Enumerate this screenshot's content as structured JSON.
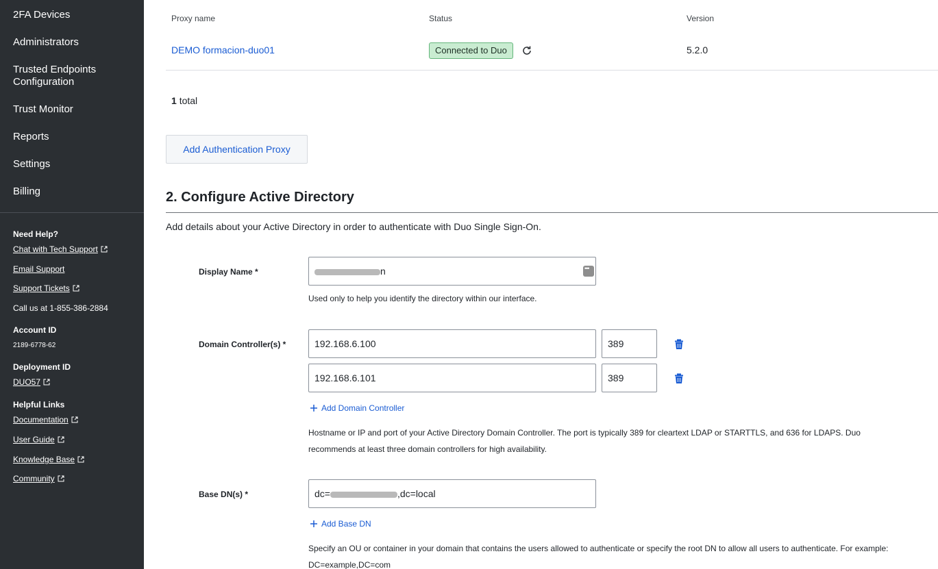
{
  "sidebar": {
    "nav": [
      "2FA Devices",
      "Administrators",
      "Trusted Endpoints\nConfiguration",
      "Trust Monitor",
      "Reports",
      "Settings",
      "Billing"
    ],
    "need_help": "Need Help?",
    "chat": "Chat with Tech Support",
    "email": "Email Support",
    "tickets": "Support Tickets",
    "call": "Call us at 1-855-386-2884",
    "account_id_label": "Account ID",
    "account_id": "2189-6778-62",
    "deployment_id_label": "Deployment ID",
    "deployment_id": "DUO57",
    "helpful_links": "Helpful Links",
    "documentation": "Documentation",
    "user_guide": "User Guide",
    "knowledge_base": "Knowledge Base",
    "community": "Community"
  },
  "proxy_table": {
    "col_name": "Proxy name",
    "col_status": "Status",
    "col_version": "Version",
    "row": {
      "name": "DEMO formacion-duo01",
      "status": "Connected to Duo",
      "version": "5.2.0"
    },
    "total_count": "1",
    "total_label": "total",
    "add_button": "Add Authentication Proxy"
  },
  "section": {
    "title": "2. Configure Active Directory",
    "description": "Add details about your Active Directory in order to authenticate with Duo Single Sign-On."
  },
  "display_name": {
    "label": "Display Name *",
    "value_suffix": "n",
    "help": "Used only to help you identify the directory within our interface."
  },
  "domain_controllers": {
    "label": "Domain Controller(s) *",
    "hosts": [
      "192.168.6.100",
      "192.168.6.101"
    ],
    "ports": [
      "389",
      "389"
    ],
    "add_label": "Add Domain Controller",
    "help_line1": "Hostname or IP and port of your Active Directory Domain Controller. The port is typically 389 for cleartext LDAP or STARTTLS, and 636 for LDAPS. Duo",
    "help_line2": "recommends at least three domain controllers for high availability."
  },
  "base_dn": {
    "label": "Base DN(s) *",
    "value_prefix": "dc=",
    "value_suffix": ",dc=local",
    "add_label": "Add Base DN",
    "help_line1": "Specify an OU or container in your domain that contains the users allowed to authenticate or specify the root DN to allow all users to authenticate. For example:",
    "help_line2": "DC=example,DC=com"
  },
  "colors": {
    "link": "#1a5cd3",
    "sidebar_bg": "#2b2f33",
    "status_bg": "#c9ecd1"
  }
}
